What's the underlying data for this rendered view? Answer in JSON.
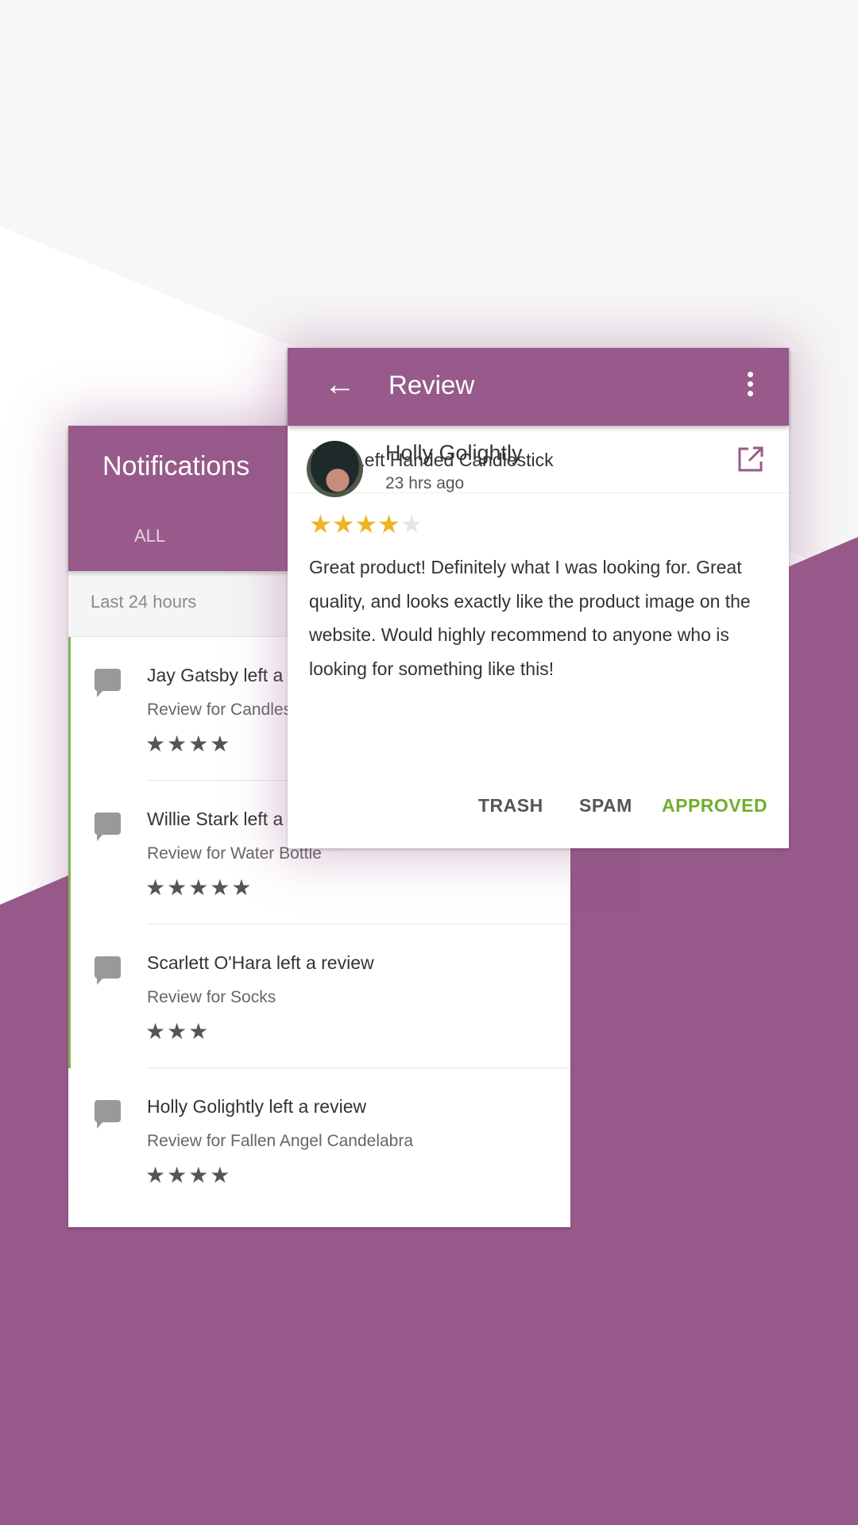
{
  "notifications": {
    "title": "Notifications",
    "tab_all": "ALL",
    "section": "Last 24 hours",
    "items": [
      {
        "title": "Jay Gatsby left a review",
        "subtitle": "Review for Candlestick",
        "stars": "★★★★",
        "unread": true
      },
      {
        "title": "Willie Stark left a review",
        "subtitle": "Review for Water Bottle",
        "stars": "★★★★★",
        "unread": true
      },
      {
        "title": "Scarlett O'Hara left a review",
        "subtitle": "Review for Socks",
        "stars": "★★★",
        "unread": true
      },
      {
        "title": "Holly Golightly left a review",
        "subtitle": "Review for Fallen Angel Candelabra",
        "stars": "★★★★",
        "unread": false
      }
    ]
  },
  "review": {
    "title": "Review",
    "back": "←",
    "product": "Left Handed Candlestick",
    "reviewer": "Holly Golightly",
    "time": "23 hrs ago",
    "rating": 4,
    "rating_max": 5,
    "stars_on": "★★★★",
    "stars_off": "★",
    "body": "Great product! Definitely what I was looking for. Great quality, and looks exactly like the product image on the website. Would highly recommend to anyone who is looking for something like this!",
    "actions": {
      "trash": "TRASH",
      "spam": "SPAM",
      "approved": "APPROVED"
    }
  },
  "colors": {
    "brand": "#975a8a",
    "approved": "#6fae2e",
    "star": "#f0b323",
    "unread_bar": "#7cb84a"
  }
}
